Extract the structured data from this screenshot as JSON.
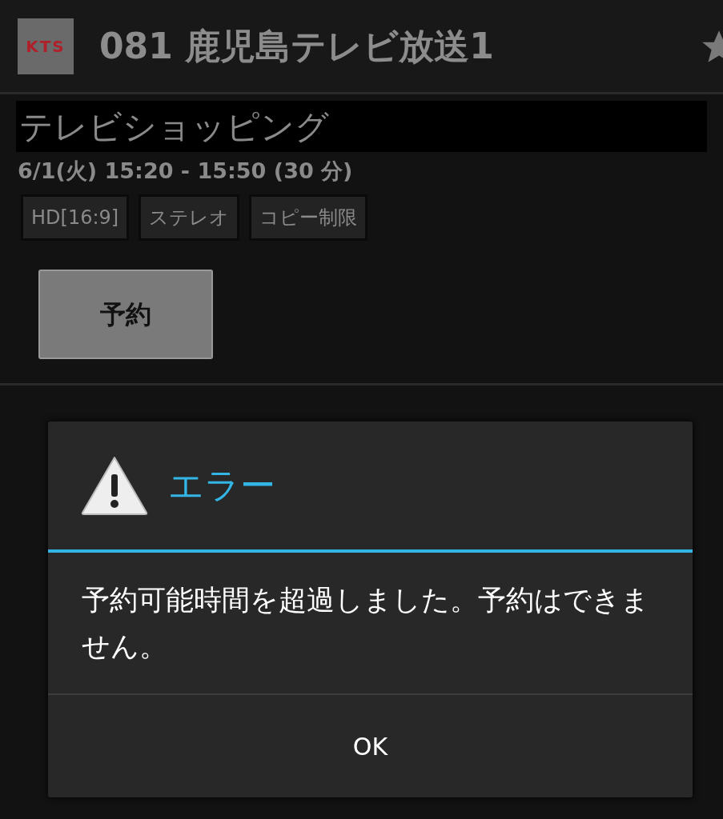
{
  "header": {
    "logo_text": "KTS",
    "channel_title": "081 鹿児島テレビ放送1"
  },
  "program": {
    "title": "テレビショッピング",
    "schedule": "6/1(火) 15:20 - 15:50 (30 分)",
    "tags": [
      "HD[16:9]",
      "ステレオ",
      "コピー制限"
    ],
    "reserve_button": "予約"
  },
  "dialog": {
    "title": "エラー",
    "message": "予約可能時間を超過しました。予約はできません。",
    "buttons": [
      "OK"
    ]
  }
}
